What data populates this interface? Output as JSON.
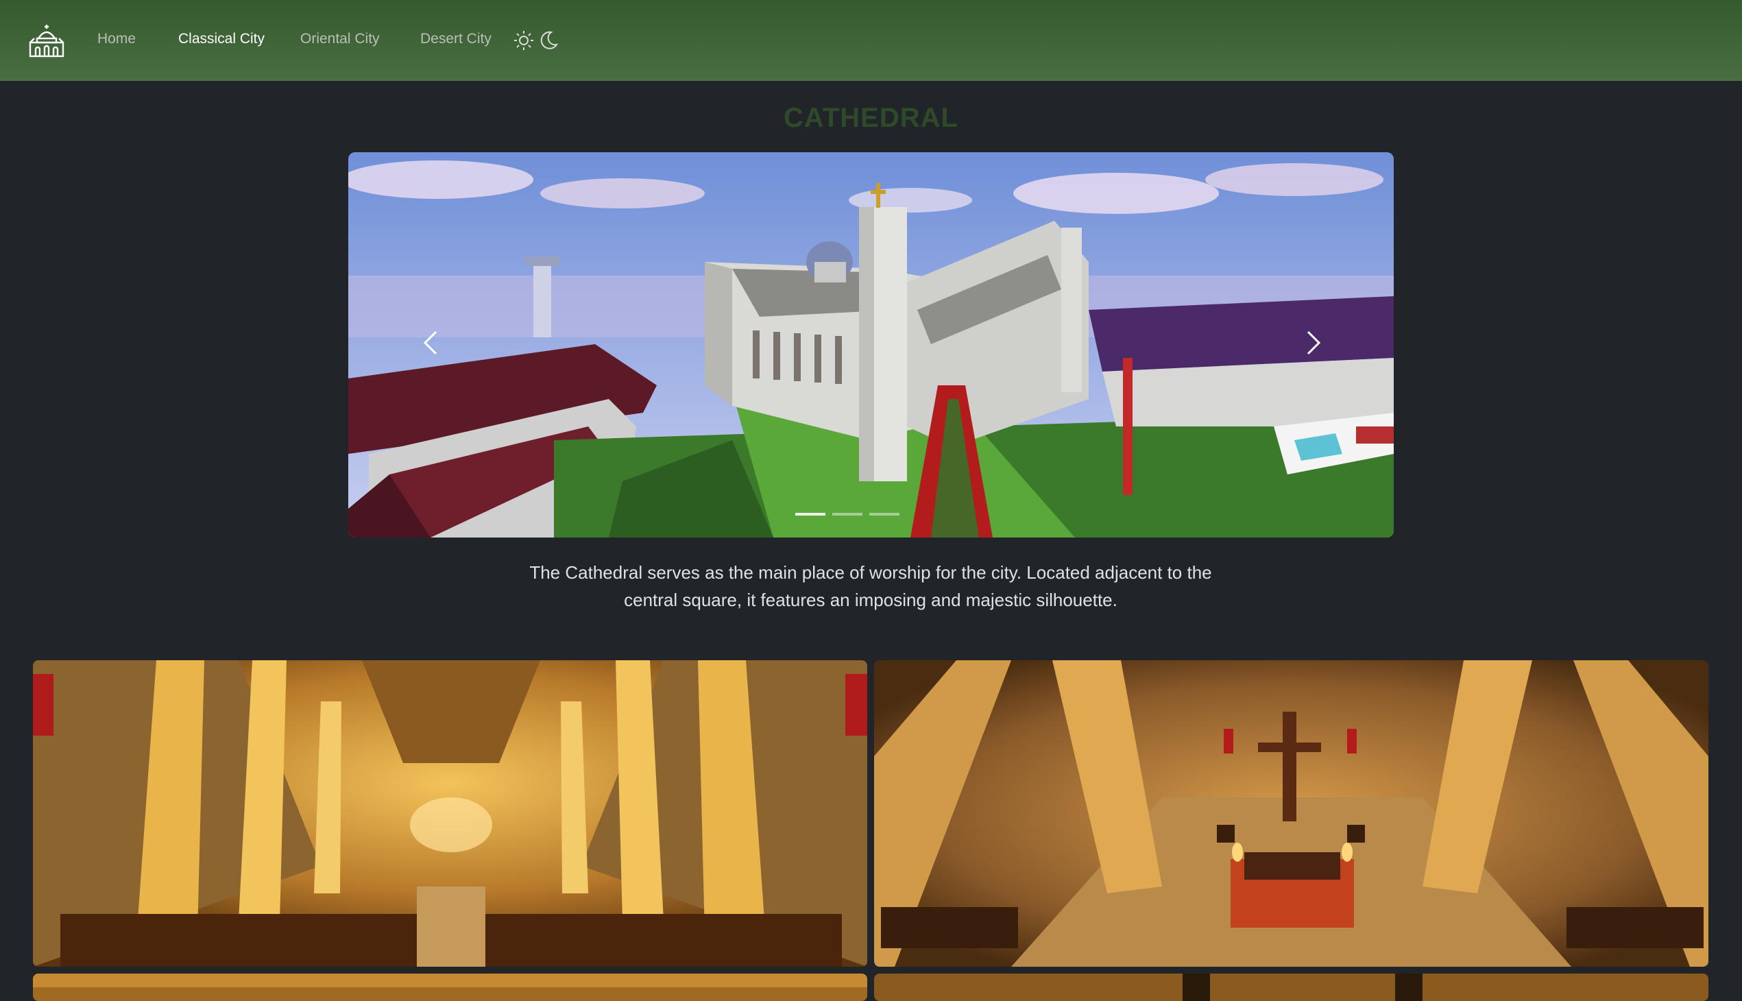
{
  "navbar": {
    "logo_icon": "cathedral-logo-icon",
    "links": [
      {
        "label": "Home",
        "active": false
      },
      {
        "label": "Classical City",
        "active": true
      },
      {
        "label": "Oriental City",
        "active": false
      },
      {
        "label": "Desert City",
        "active": false
      }
    ],
    "theme_icons": [
      "sun-icon",
      "moon-icon"
    ],
    "colors": {
      "bar_top": "#355a2d",
      "bar_bottom": "#4a6e41",
      "link": "#b8c0b5",
      "link_active": "#ffffff"
    }
  },
  "page": {
    "title": "CATHEDRAL",
    "title_color": "#2e4a28",
    "background": "#212529"
  },
  "carousel": {
    "prev_icon": "chevron-left-icon",
    "next_icon": "chevron-right-icon",
    "slide_count": 3,
    "active_slide": 1
  },
  "description": {
    "text": "The Cathedral serves as the main place of worship for the city. Located adjacent to the central square, it features an imposing and majestic silhouette."
  },
  "gallery": {
    "images": [
      "cathedral-nave-interior",
      "cathedral-altar-interior",
      "gallery-image-3",
      "gallery-image-4"
    ]
  }
}
